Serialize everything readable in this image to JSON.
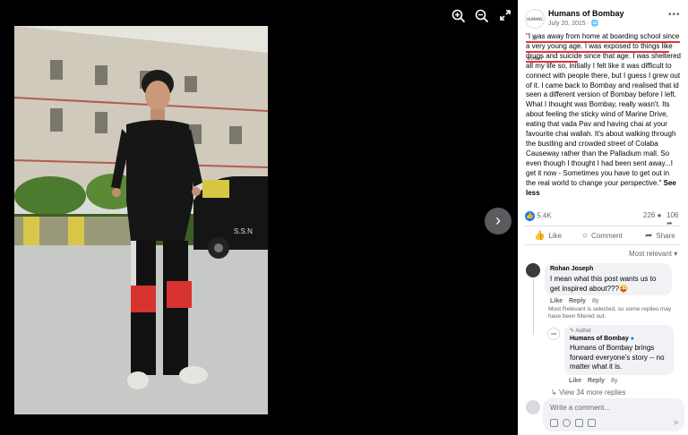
{
  "viewer": {
    "icons": [
      "zoom-in-icon",
      "zoom-out-icon",
      "fullscreen-icon"
    ],
    "next_icon": "chevron-right-icon",
    "photo_sign": "S.S.N"
  },
  "post": {
    "page_logo_text": "HUMANS OF BOMBAY",
    "page_name": "Humans of Bombay",
    "date": "July 20, 2015 · ",
    "caption_lines": [
      "\"I was away from home at boarding school since",
      "a very young age. I was exposed to things like",
      "drugs and suicide since that age. I was sheltered",
      "all my life so, initially I felt like it was difficult to",
      "connect with people there, but I guess I grew out",
      "of it. I came back to Bombay and realised that id",
      "seen a different version of Bombay before I left.",
      "What I thought was Bombay, really wasn't. Its",
      "about feeling the sticky wind of Marine Drive,",
      "eating that vada Pav and having chai at your",
      "favourite chai wallah. It's about walking through",
      "the bustling and crowded street of Colaba",
      "Causeway rather than the Palladium mall. So",
      "even though I thought I had been sent away...I",
      "get it now - Sometimes you have to get out in",
      "the real world to change your perspective.\""
    ],
    "see_more_1": "See",
    "see_more_2": "less",
    "reactions": "5.4K",
    "comments_count": "226",
    "shares_count": "106"
  },
  "actions": {
    "like": "Like",
    "comment": "Comment",
    "share": "Share"
  },
  "filter": {
    "label": "Most relevant"
  },
  "comment1": {
    "author": "Rohan Joseph",
    "text_line1": "I mean what this post wants us to",
    "text_line2": "get inspired about???",
    "emoji": "😜",
    "like": "Like",
    "reply": "Reply",
    "time": "8y",
    "note": "Most Relevant is selected, so some replies may have been filtered out."
  },
  "reply1": {
    "badge": "Author",
    "author": "Humans of Bombay",
    "text_lines": [
      "Humans of Bombay brings",
      "forward everyone's story -- no",
      "matter what it is."
    ],
    "like": "Like",
    "reply": "Reply",
    "time": "8y"
  },
  "view_replies": "View 34 more replies",
  "composer": {
    "placeholder": "Write a comment..."
  },
  "colors": {
    "accent": "#1877f2",
    "underline": "#e3323b",
    "bubble": "#f0f2f5"
  }
}
